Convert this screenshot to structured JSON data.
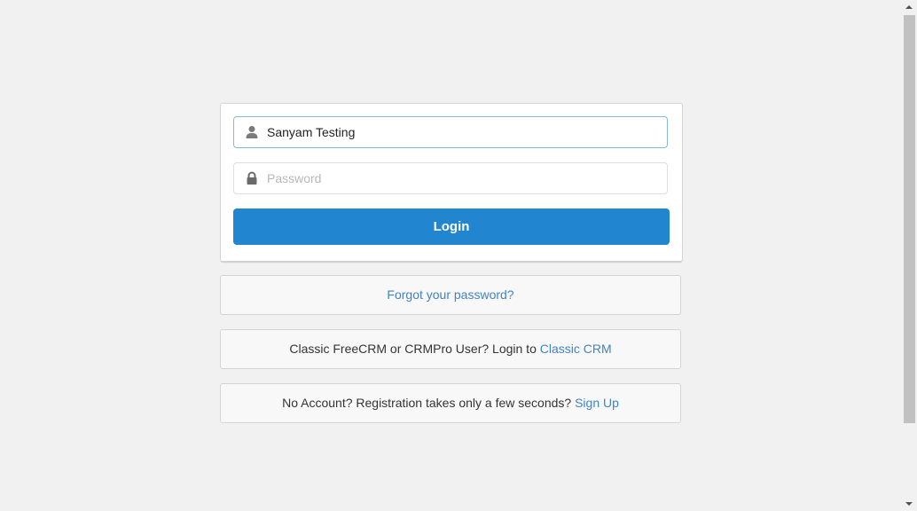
{
  "login_form": {
    "username_value": "Sanyam Testing",
    "password_placeholder": "Password",
    "login_label": "Login"
  },
  "forgot": {
    "link_text": "Forgot your password?"
  },
  "classic": {
    "text": "Classic FreeCRM or CRMPro User? Login to ",
    "link_text": "Classic CRM"
  },
  "signup": {
    "text": "No Account? Registration takes only a few seconds? ",
    "link_text": "Sign Up"
  },
  "icons": {
    "username": "user-icon",
    "password": "lock-icon"
  },
  "colors": {
    "primary": "#2185d0",
    "link": "#4183c4",
    "background": "#f1f1f1"
  }
}
